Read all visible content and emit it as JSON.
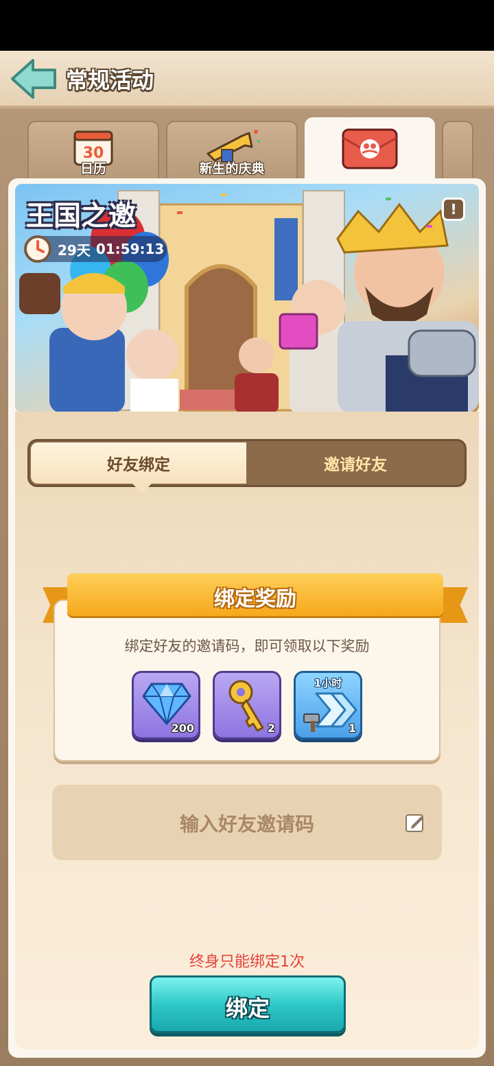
{
  "header": {
    "title": "常规活动"
  },
  "tabs": [
    {
      "label": "日历",
      "icon": "calendar-icon",
      "calendar_day": "30"
    },
    {
      "label": "新生的庆典",
      "icon": "trumpet-icon"
    },
    {
      "label": "",
      "icon": "invite-friends-icon"
    }
  ],
  "banner": {
    "title": "王国之邀",
    "timer_days": "29天",
    "timer_time": "01:59:13"
  },
  "segment": {
    "left": "好友绑定",
    "right": "邀请好友"
  },
  "reward": {
    "title": "绑定奖励",
    "description": "绑定好友的邀请码，即可领取以下奖励",
    "items": [
      {
        "icon": "diamond-icon",
        "count": "200"
      },
      {
        "icon": "golden-key-icon",
        "count": "2"
      },
      {
        "icon": "speedup-hammer-icon",
        "label": "1小时",
        "count": "1"
      }
    ]
  },
  "input": {
    "placeholder": "输入好友邀请码"
  },
  "warning": "终身只能绑定1次",
  "bind_button": "绑定",
  "colors": {
    "accent": "#2ec8c8",
    "warning": "#e5423a",
    "ribbon": "#f5a81c"
  }
}
